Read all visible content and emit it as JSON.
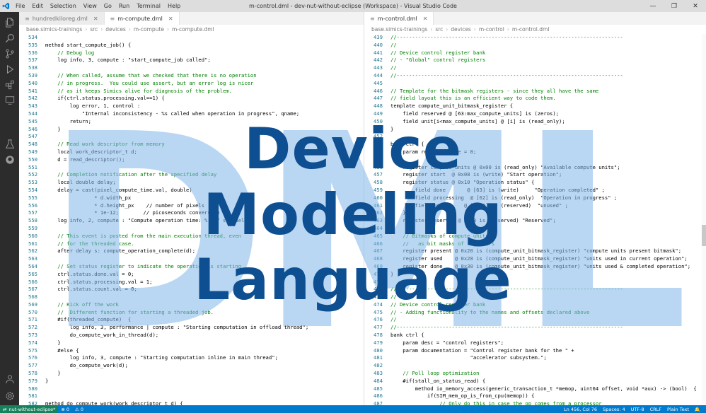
{
  "titlebar": {
    "menu": [
      "File",
      "Edit",
      "Selection",
      "View",
      "Go",
      "Run",
      "Terminal",
      "Help"
    ],
    "title": "m-control.dml - dev-nut-without-eclipse (Workspace) - Visual Studio Code",
    "min": "—",
    "max": "❐",
    "close": "✕"
  },
  "activity_icons": [
    "files-icon",
    "search-icon",
    "source-control-icon",
    "run-debug-icon",
    "extensions-icon",
    "remote-explorer-icon",
    "testing-icon",
    "github-icon"
  ],
  "left_editor": {
    "tabs": [
      {
        "label": "hundredkiloreg.dml",
        "active": false
      },
      {
        "label": "m-compute.dml",
        "active": true
      }
    ],
    "breadcrumb": [
      "base.simics-trainings",
      "src",
      "devices",
      "m-compute",
      "m-compute.dml"
    ],
    "lines": [
      {
        "n": "534",
        "t": ""
      },
      {
        "n": "535",
        "t": "method start_compute_job() {"
      },
      {
        "n": "536",
        "t": "    // Debug log",
        "c": true
      },
      {
        "n": "537",
        "t": "    log info, 3, compute : \"start_compute_job called\";"
      },
      {
        "n": "538",
        "t": ""
      },
      {
        "n": "539",
        "t": "    // When called, assume that we checked that there is no operation",
        "c": true
      },
      {
        "n": "540",
        "t": "    // in progress.  You could use assert, but an error log is nicer",
        "c": true
      },
      {
        "n": "541",
        "t": "    // as it keeps Simics alive for diagnosis of the problem.",
        "c": true
      },
      {
        "n": "542",
        "t": "    if(ctrl.status.processing.val==1) {"
      },
      {
        "n": "543",
        "t": "        log error, 1, control :"
      },
      {
        "n": "544",
        "t": "            \"Internal inconsistency - %s called when operation in progress\", qname;"
      },
      {
        "n": "545",
        "t": "        return;"
      },
      {
        "n": "546",
        "t": "    }"
      },
      {
        "n": "547",
        "t": ""
      },
      {
        "n": "548",
        "t": "    // Read work descriptor from memory",
        "c": true
      },
      {
        "n": "549",
        "t": "    local work_descriptor_t d;"
      },
      {
        "n": "550",
        "t": "    d = read_descriptor();"
      },
      {
        "n": "551",
        "t": ""
      },
      {
        "n": "552",
        "t": "    // Completion notification after the specified delay",
        "c": true
      },
      {
        "n": "553",
        "t": "    local double delay;"
      },
      {
        "n": "554",
        "t": "    delay = cast(pixel_compute_time.val, double)"
      },
      {
        "n": "555",
        "t": "                * d.width_px"
      },
      {
        "n": "556",
        "t": "                * d.height_px    // number of pixels"
      },
      {
        "n": "557",
        "t": "                * 1e-12;        // picoseconds conversion"
      },
      {
        "n": "558",
        "t": "    log info, 2, compute : \"Compute operation time: %.10f s\", delay;"
      },
      {
        "n": "559",
        "t": ""
      },
      {
        "n": "560",
        "t": "    // This event is posted from the main execution thread, even",
        "c": true
      },
      {
        "n": "561",
        "t": "    // for the threaded case.",
        "c": true
      },
      {
        "n": "562",
        "t": "    after delay s: compute_operation_complete(d);"
      },
      {
        "n": "563",
        "t": ""
      },
      {
        "n": "564",
        "t": "    // Set status register to indicate the operation is starting",
        "c": true
      },
      {
        "n": "565",
        "t": "    ctrl.status.done.val = 0;"
      },
      {
        "n": "566",
        "t": "    ctrl.status.processing.val = 1;"
      },
      {
        "n": "567",
        "t": "    ctrl.status.count.val = 0;"
      },
      {
        "n": "568",
        "t": ""
      },
      {
        "n": "569",
        "t": "    // Kick off the work",
        "c": true
      },
      {
        "n": "570",
        "t": "    //  Different function for starting a threaded job.",
        "c": true
      },
      {
        "n": "571",
        "t": "    #if(threaded_compute)  {"
      },
      {
        "n": "572",
        "t": "        log info, 3, performance | compute : \"Starting computation in offload thread\";"
      },
      {
        "n": "573",
        "t": "        do_compute_work_in_thread(d);"
      },
      {
        "n": "574",
        "t": "    }"
      },
      {
        "n": "575",
        "t": "    #else {"
      },
      {
        "n": "576",
        "t": "        log info, 3, compute : \"Starting computation inline in main thread\";"
      },
      {
        "n": "577",
        "t": "        do_compute_work(d);"
      },
      {
        "n": "578",
        "t": "    }"
      },
      {
        "n": "579",
        "t": "}"
      },
      {
        "n": "580",
        "t": ""
      },
      {
        "n": "581",
        "t": ""
      },
      {
        "n": "582",
        "t": "method do_compute_work(work_descriptor_t d) {"
      },
      {
        "n": "583",
        "t": ""
      }
    ]
  },
  "right_editor": {
    "tabs": [
      {
        "label": "m-control.dml",
        "active": true
      }
    ],
    "breadcrumb": [
      "base.simics-trainings",
      "src",
      "devices",
      "m-control",
      "m-control.dml"
    ],
    "lines": [
      {
        "n": "439",
        "t": "//--------------------------------------------------------------------------",
        "c": true
      },
      {
        "n": "440",
        "t": "//",
        "c": true
      },
      {
        "n": "441",
        "t": "// Device control register bank",
        "c": true
      },
      {
        "n": "442",
        "t": "// - \"Global\" control registers",
        "c": true
      },
      {
        "n": "443",
        "t": "//",
        "c": true
      },
      {
        "n": "444",
        "t": "//--------------------------------------------------------------------------",
        "c": true
      },
      {
        "n": "445",
        "t": ""
      },
      {
        "n": "446",
        "t": "// Template for the bitmask registers - since they all have the same",
        "c": true
      },
      {
        "n": "447",
        "t": "// field layout this is an efficient way to code them.",
        "c": true
      },
      {
        "n": "448",
        "t": "template compute_unit_bitmask_register {"
      },
      {
        "n": "449",
        "t": "    field reserved @ [63:max_compute_units] is (zeros);"
      },
      {
        "n": "450",
        "t": "    field unit[i<max_compute_units] @ [i] is (read_only);"
      },
      {
        "n": "451",
        "t": "}"
      },
      {
        "n": "452",
        "t": ""
      },
      {
        "n": "453",
        "t": "bank ctrl {"
      },
      {
        "n": "454",
        "t": "    param register_size = 8;"
      },
      {
        "n": "455",
        "t": ""
      },
      {
        "n": "456",
        "t": "    register compute_units @ 0x00 is (read_only) \"Available compute units\";"
      },
      {
        "n": "457",
        "t": "    register start  @ 0x08 is (write) \"Start operation\";"
      },
      {
        "n": "458",
        "t": "    register status @ 0x10 \"Operation status\" {"
      },
      {
        "n": "459",
        "t": "        field done       @ [63] is (write)     \"Operation completed\" ;"
      },
      {
        "n": "460",
        "t": "        field processing  @ [62] is (read_only)  \"Operation in progress\" ;"
      },
      {
        "n": "461",
        "t": "        field unused    @ [61:0] is (reserved)  \"unused\" ;"
      },
      {
        "n": "462",
        "t": "    }"
      },
      {
        "n": "463",
        "t": "    register reserved @ 0x18 is (reserved) \"Reserved\";"
      },
      {
        "n": "464",
        "t": ""
      },
      {
        "n": "465",
        "t": "    // Bitmasks of compute units",
        "c": true
      },
      {
        "n": "466",
        "t": "    //   as bit masks of registers",
        "c": true
      },
      {
        "n": "467",
        "t": "    register present @ 0x20 is (compute_unit_bitmask_register) \"compute units present bitmask\";"
      },
      {
        "n": "468",
        "t": "    register used    @ 0x28 is (compute_unit_bitmask_register) \"units used in current operation\";"
      },
      {
        "n": "469",
        "t": "    register done    @ 0x30 is (compute_unit_bitmask_register) \"units used & completed operation\";"
      },
      {
        "n": "470",
        "t": "}"
      },
      {
        "n": "471",
        "t": ""
      },
      {
        "n": "472",
        "t": "//--------------------------------------------------------------------------",
        "c": true
      },
      {
        "n": "473",
        "t": "//",
        "c": true
      },
      {
        "n": "474",
        "t": "// Device control register bank",
        "c": true
      },
      {
        "n": "475",
        "t": "// - Adding functionality to the names and offsets declared above",
        "c": true
      },
      {
        "n": "476",
        "t": "//",
        "c": true
      },
      {
        "n": "477",
        "t": "//--------------------------------------------------------------------------",
        "c": true
      },
      {
        "n": "478",
        "t": "bank ctrl {"
      },
      {
        "n": "479",
        "t": "    param desc = \"control registers\";"
      },
      {
        "n": "480",
        "t": "    param documentation = \"Control register bank for the \" +"
      },
      {
        "n": "481",
        "t": "                          \"accelerator subsystem.\";"
      },
      {
        "n": "482",
        "t": ""
      },
      {
        "n": "483",
        "t": "    // Poll loop optimization",
        "c": true
      },
      {
        "n": "484",
        "t": "    #if(stall_on_status_read) {"
      },
      {
        "n": "485",
        "t": "        method io_memory_access(generic_transaction_t *memop, uint64 offset, void *aux) -> (bool)  {"
      },
      {
        "n": "486",
        "t": "            if(SIM_mem_op_is_from_cpu(memop)) {"
      },
      {
        "n": "487",
        "t": "                // Only do this in case the op comes from a processor",
        "c": true
      },
      {
        "n": "488",
        "t": "                return default(memop, offset, SIM_get_mem_op_initiator(memop));"
      },
      {
        "n": "489",
        "t": ""
      }
    ]
  },
  "headline": [
    "Device",
    "Modeling",
    "Language"
  ],
  "watermark": "DML",
  "statusbar": {
    "remote": "nut-without-eclipse*",
    "errors": "⊗ 0",
    "warnings": "⚠ 0",
    "position": "Ln 456, Col 76",
    "spaces": "Spaces: 4",
    "encoding": "UTF-8",
    "eol": "CRLF",
    "language": "Plain Text"
  },
  "colors": {
    "headline": "#0d4f91",
    "watermark": "#7fb5ea",
    "statusbar": "#007acc"
  }
}
